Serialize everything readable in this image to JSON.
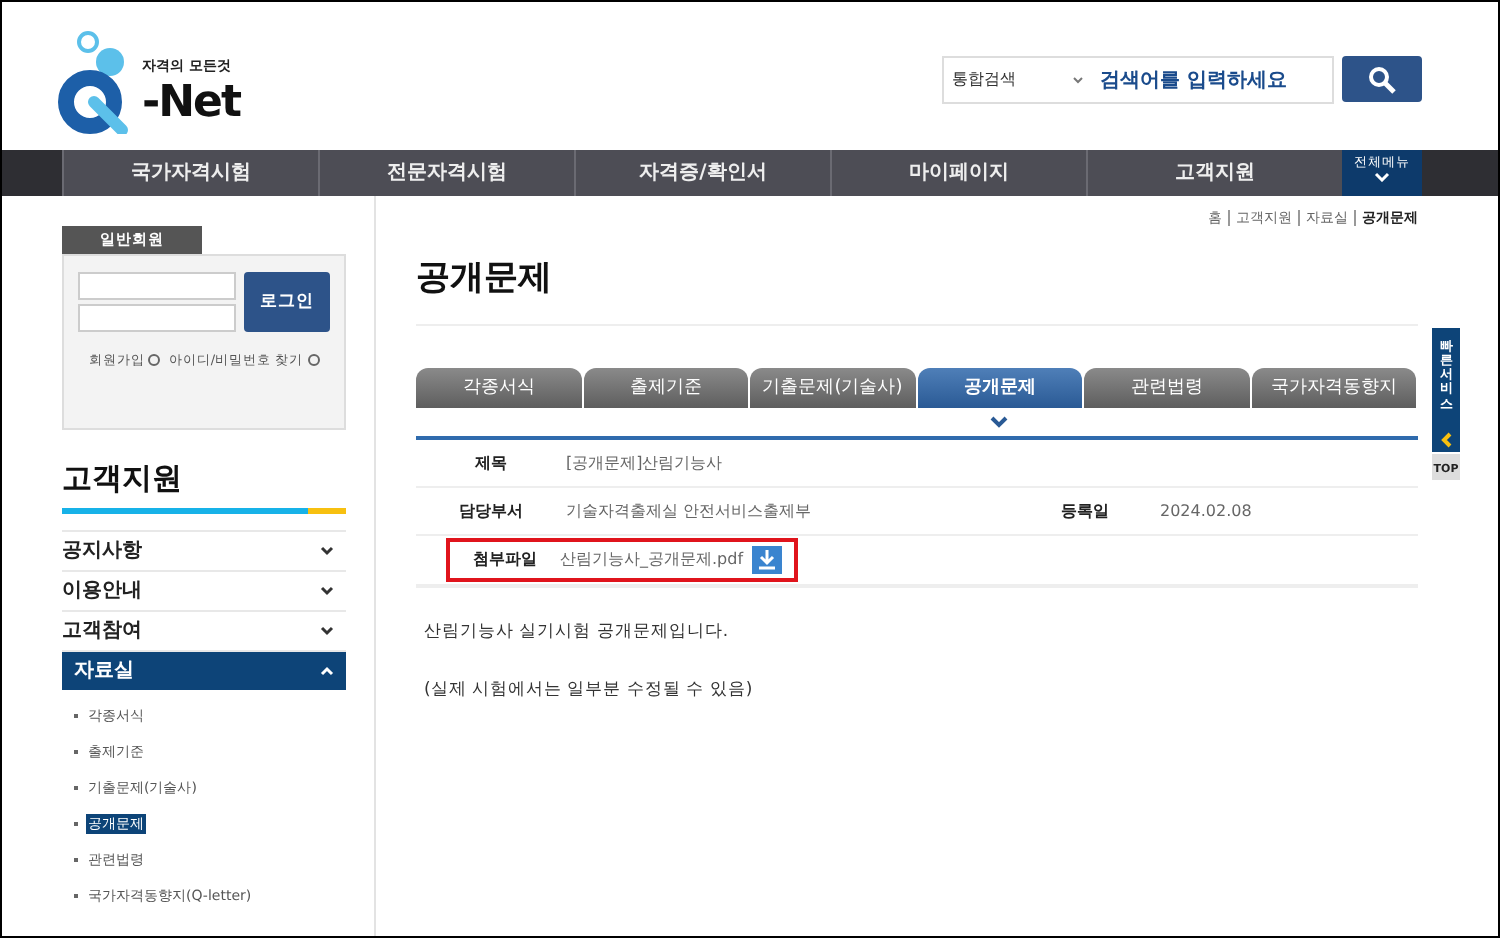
{
  "logo": {
    "tagline": "자격의 모든것",
    "name": "-Net"
  },
  "search": {
    "scope": "통합검색",
    "placeholder": "검색어를 입력하세요"
  },
  "nav": [
    "국가자격시험",
    "전문자격시험",
    "자격증/확인서",
    "마이페이지",
    "고객지원"
  ],
  "all_menu": "전체메뉴",
  "login": {
    "tab": "일반회원",
    "button": "로그인",
    "links": [
      "회원가입",
      "아이디/비밀번호 찾기"
    ]
  },
  "sidebar": {
    "title": "고객지원",
    "items": [
      {
        "label": "공지사항",
        "expanded": false
      },
      {
        "label": "이용안내",
        "expanded": false
      },
      {
        "label": "고객참여",
        "expanded": false
      },
      {
        "label": "자료실",
        "expanded": true,
        "children": [
          {
            "label": "각종서식",
            "selected": false
          },
          {
            "label": "출제기준",
            "selected": false
          },
          {
            "label": "기출문제(기술사)",
            "selected": false
          },
          {
            "label": "공개문제",
            "selected": true
          },
          {
            "label": "관련법령",
            "selected": false
          },
          {
            "label": "국가자격동향지(Q-letter)",
            "selected": false
          }
        ]
      }
    ]
  },
  "breadcrumb": [
    "홈",
    "고객지원",
    "자료실",
    "공개문제"
  ],
  "page_title": "공개문제",
  "tabs": [
    {
      "label": "각종서식",
      "selected": false
    },
    {
      "label": "출제기준",
      "selected": false
    },
    {
      "label": "기출문제(기술사)",
      "selected": false
    },
    {
      "label": "공개문제",
      "selected": true
    },
    {
      "label": "관련법령",
      "selected": false
    },
    {
      "label": "국가자격동향지",
      "selected": false
    }
  ],
  "post": {
    "title_label": "제목",
    "title": "[공개문제]산림기능사",
    "dept_label": "담당부서",
    "dept": "기술자격출제실 안전서비스출제부",
    "date_label": "등록일",
    "date": "2024.02.08",
    "file_label": "첨부파일",
    "file": "산림기능사_공개문제.pdf",
    "file_highlighted": true,
    "body": [
      "산림기능사 실기시험 공개문제입니다.",
      "(실제 시험에서는 일부분 수정될 수 있음)"
    ]
  },
  "quick": {
    "label": "빠른서비스",
    "top": "TOP"
  }
}
